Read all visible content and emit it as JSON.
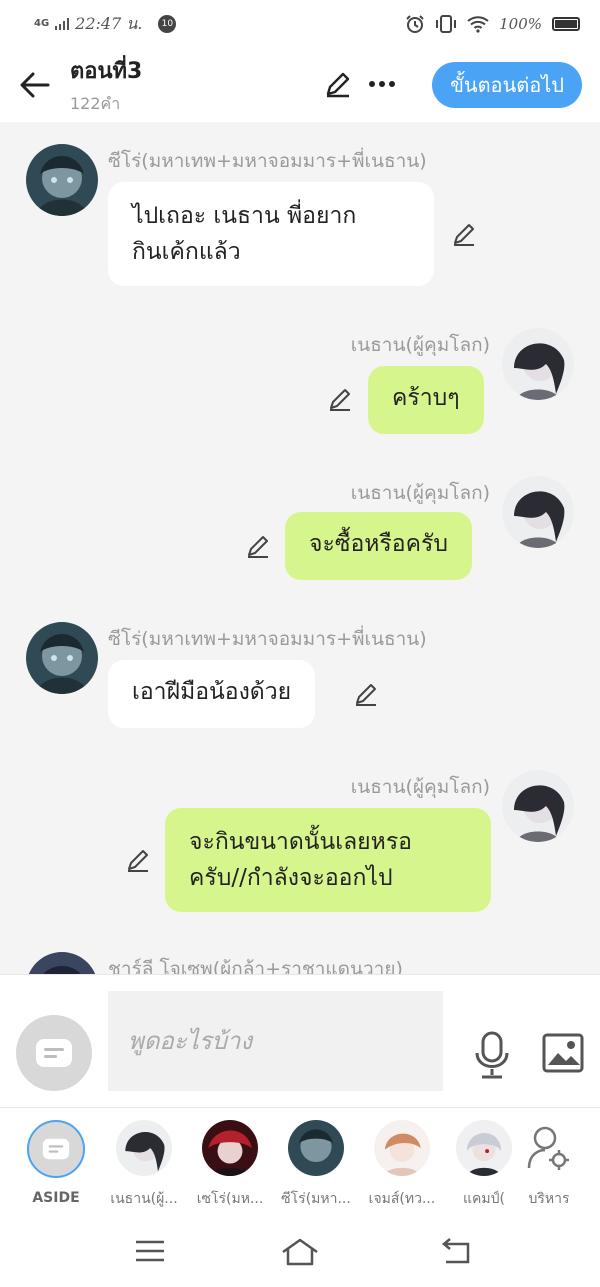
{
  "status_bar": {
    "network": "4G",
    "time": "22:47 น.",
    "notification_count": "10",
    "battery": "100%"
  },
  "header": {
    "title": "ตอนที่3",
    "subtitle": "122คำ",
    "next_label": "ขั้นตอนต่อไป"
  },
  "messages": [
    {
      "side": "left",
      "speaker": "ซีโร่(มหาเทพ+มหาจอมมาร+พี่เนธาน)",
      "text": "ไปเถอะ เนธาน พี่อยาก\nกินเค้กแล้ว"
    },
    {
      "side": "right",
      "speaker": "เนธาน(ผู้คุมโลก)",
      "text": "คร้าบๆ"
    },
    {
      "side": "right",
      "speaker": "เนธาน(ผู้คุมโลก)",
      "text": "จะซื้อหรือครับ"
    },
    {
      "side": "left",
      "speaker": "ซีโร่(มหาเทพ+มหาจอมมาร+พี่เนธาน)",
      "text": "เอาฝีมือน้องด้วย"
    },
    {
      "side": "right",
      "speaker": "เนธาน(ผู้คุมโลก)",
      "text": "จะกินขนาดนั้นเลยหรอ\nครับ//กำลังจะออกไป"
    },
    {
      "side": "left",
      "speaker": "ชาร์ลี โจเซพ(ผู้กล้า+ราชาแดนวาย)",
      "text": ""
    }
  ],
  "input": {
    "placeholder": "พูดอะไรบ้าง"
  },
  "characters": [
    {
      "label": "ASIDE"
    },
    {
      "label": "เนธาน(ผู้..."
    },
    {
      "label": "เซโร่(มห..."
    },
    {
      "label": "ซีโร่(มหา..."
    },
    {
      "label": "เจมส์(ทว..."
    },
    {
      "label": "แคมป์("
    },
    {
      "label": "บริหาร"
    }
  ],
  "colors": {
    "accent": "#4ba3f5",
    "bubble_right": "#d7f58d",
    "bubble_left": "#ffffff",
    "background": "#f4f4f4"
  }
}
